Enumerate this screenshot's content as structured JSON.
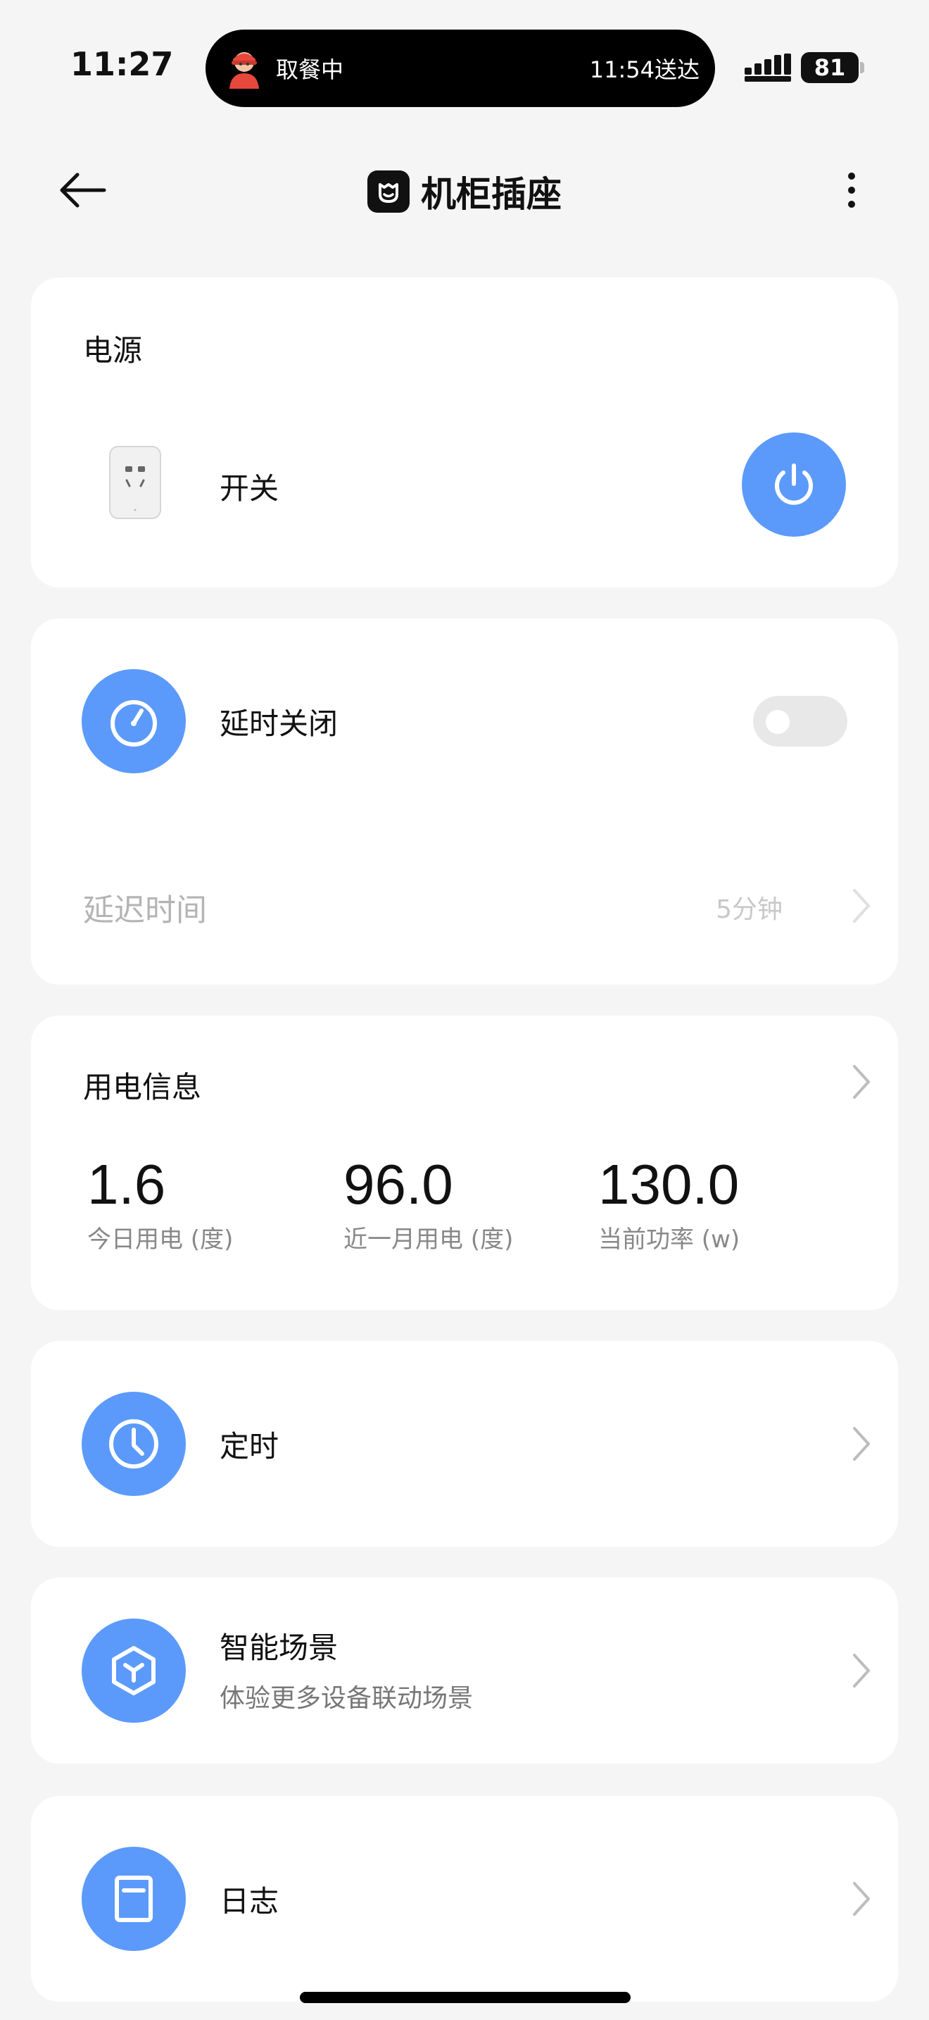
{
  "status_bar": {
    "time": "11:27",
    "island_order": "取餐中",
    "island_eta": "11:54送达",
    "battery": "81"
  },
  "header": {
    "title": "机柜插座"
  },
  "power_card": {
    "title": "电源",
    "switch_label": "开关"
  },
  "delay_card": {
    "title": "延时关闭",
    "toggle_on": false,
    "delay_label": "延迟时间",
    "delay_value": "5分钟"
  },
  "usage_card": {
    "title": "用电信息",
    "stats": [
      {
        "value": "1.6",
        "label": "今日用电 (度)"
      },
      {
        "value": "96.0",
        "label": "近一月用电 (度)"
      },
      {
        "value": "130.0",
        "label": "当前功率 (w)"
      }
    ]
  },
  "timer_card": {
    "title": "定时"
  },
  "scene_card": {
    "title": "智能场景",
    "subtitle": "体验更多设备联动场景"
  },
  "log_card": {
    "title": "日志"
  },
  "colors": {
    "accent": "#5b9afa",
    "background": "#f5f5f5",
    "card": "#ffffff"
  }
}
